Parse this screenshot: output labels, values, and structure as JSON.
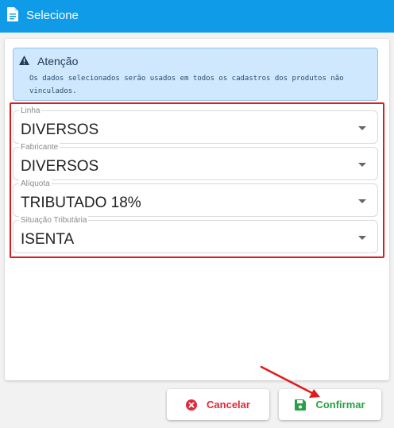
{
  "window": {
    "title": "Selecione"
  },
  "alert": {
    "title": "Atenção",
    "text": "Os dados selecionados serão usados em todos os cadastros dos produtos não vinculados."
  },
  "fields": [
    {
      "label": "Linha",
      "value": "DIVERSOS"
    },
    {
      "label": "Fabricante",
      "value": "DIVERSOS"
    },
    {
      "label": "Alíquota",
      "value": "TRIBUTADO 18%"
    },
    {
      "label": "Situação Tributária",
      "value": "ISENTA"
    }
  ],
  "buttons": {
    "cancel": "Cancelar",
    "confirm": "Confirmar"
  },
  "colors": {
    "titlebar": "#0f9be8",
    "alert_bg": "#cfe8fd",
    "highlight": "#e01b1b",
    "cancel": "#e0283a",
    "confirm": "#27a146"
  }
}
